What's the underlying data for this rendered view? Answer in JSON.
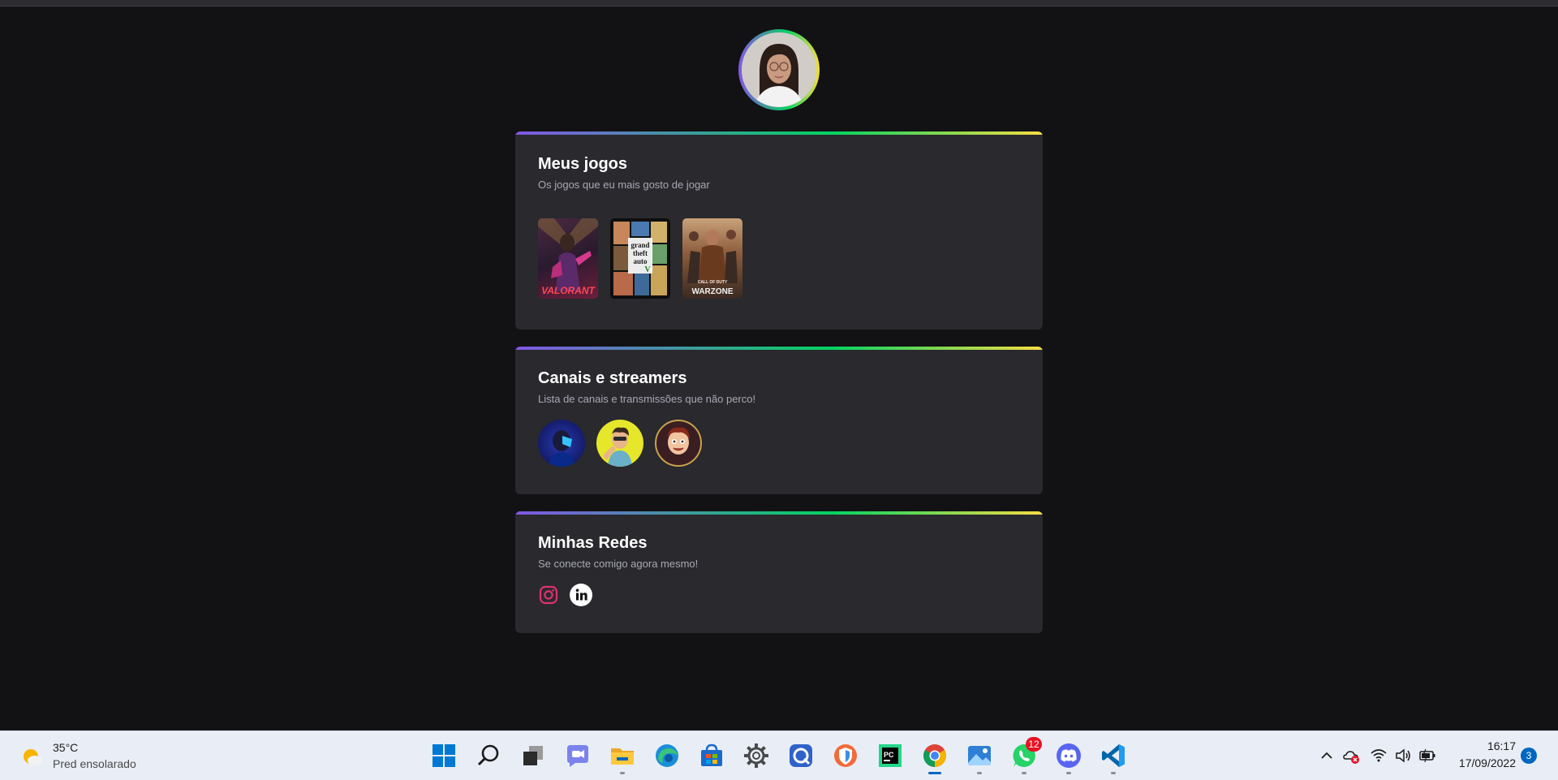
{
  "profile": {
    "avatar": "profile-photo"
  },
  "games_section": {
    "title": "Meus jogos",
    "subtitle": "Os jogos que eu mais gosto de jogar",
    "games": [
      {
        "name": "Valorant",
        "cover_text": "VALORANT"
      },
      {
        "name": "Grand Theft Auto V",
        "cover_text": "grand theft auto"
      },
      {
        "name": "Call of Duty Warzone",
        "cover_text": "WARZONE",
        "cover_small": "CALL OF DUTY"
      }
    ]
  },
  "channels_section": {
    "title": "Canais e streamers",
    "subtitle": "Lista de canais e transmissões que não perco!",
    "channels": [
      "channel-avatar-1",
      "channel-avatar-2",
      "channel-avatar-3"
    ]
  },
  "networks_section": {
    "title": "Minhas Redes",
    "subtitle": "Se conecte comigo agora mesmo!",
    "links": [
      {
        "icon": "instagram-icon",
        "color": "#e1306c"
      },
      {
        "icon": "linkedin-icon",
        "color": "#ffffff"
      }
    ]
  },
  "taskbar": {
    "weather": {
      "temp": "35°C",
      "condition": "Pred ensolarado"
    },
    "apps": [
      "start",
      "search",
      "task-view",
      "teams",
      "file-explorer",
      "edge",
      "store",
      "settings",
      "app-c",
      "app-shield",
      "pycharm",
      "chrome",
      "photos",
      "whatsapp",
      "discord",
      "vscode"
    ],
    "whatsapp_badge": "12",
    "clock": {
      "time": "16:17",
      "date": "17/09/2022"
    },
    "notifications": "3"
  }
}
